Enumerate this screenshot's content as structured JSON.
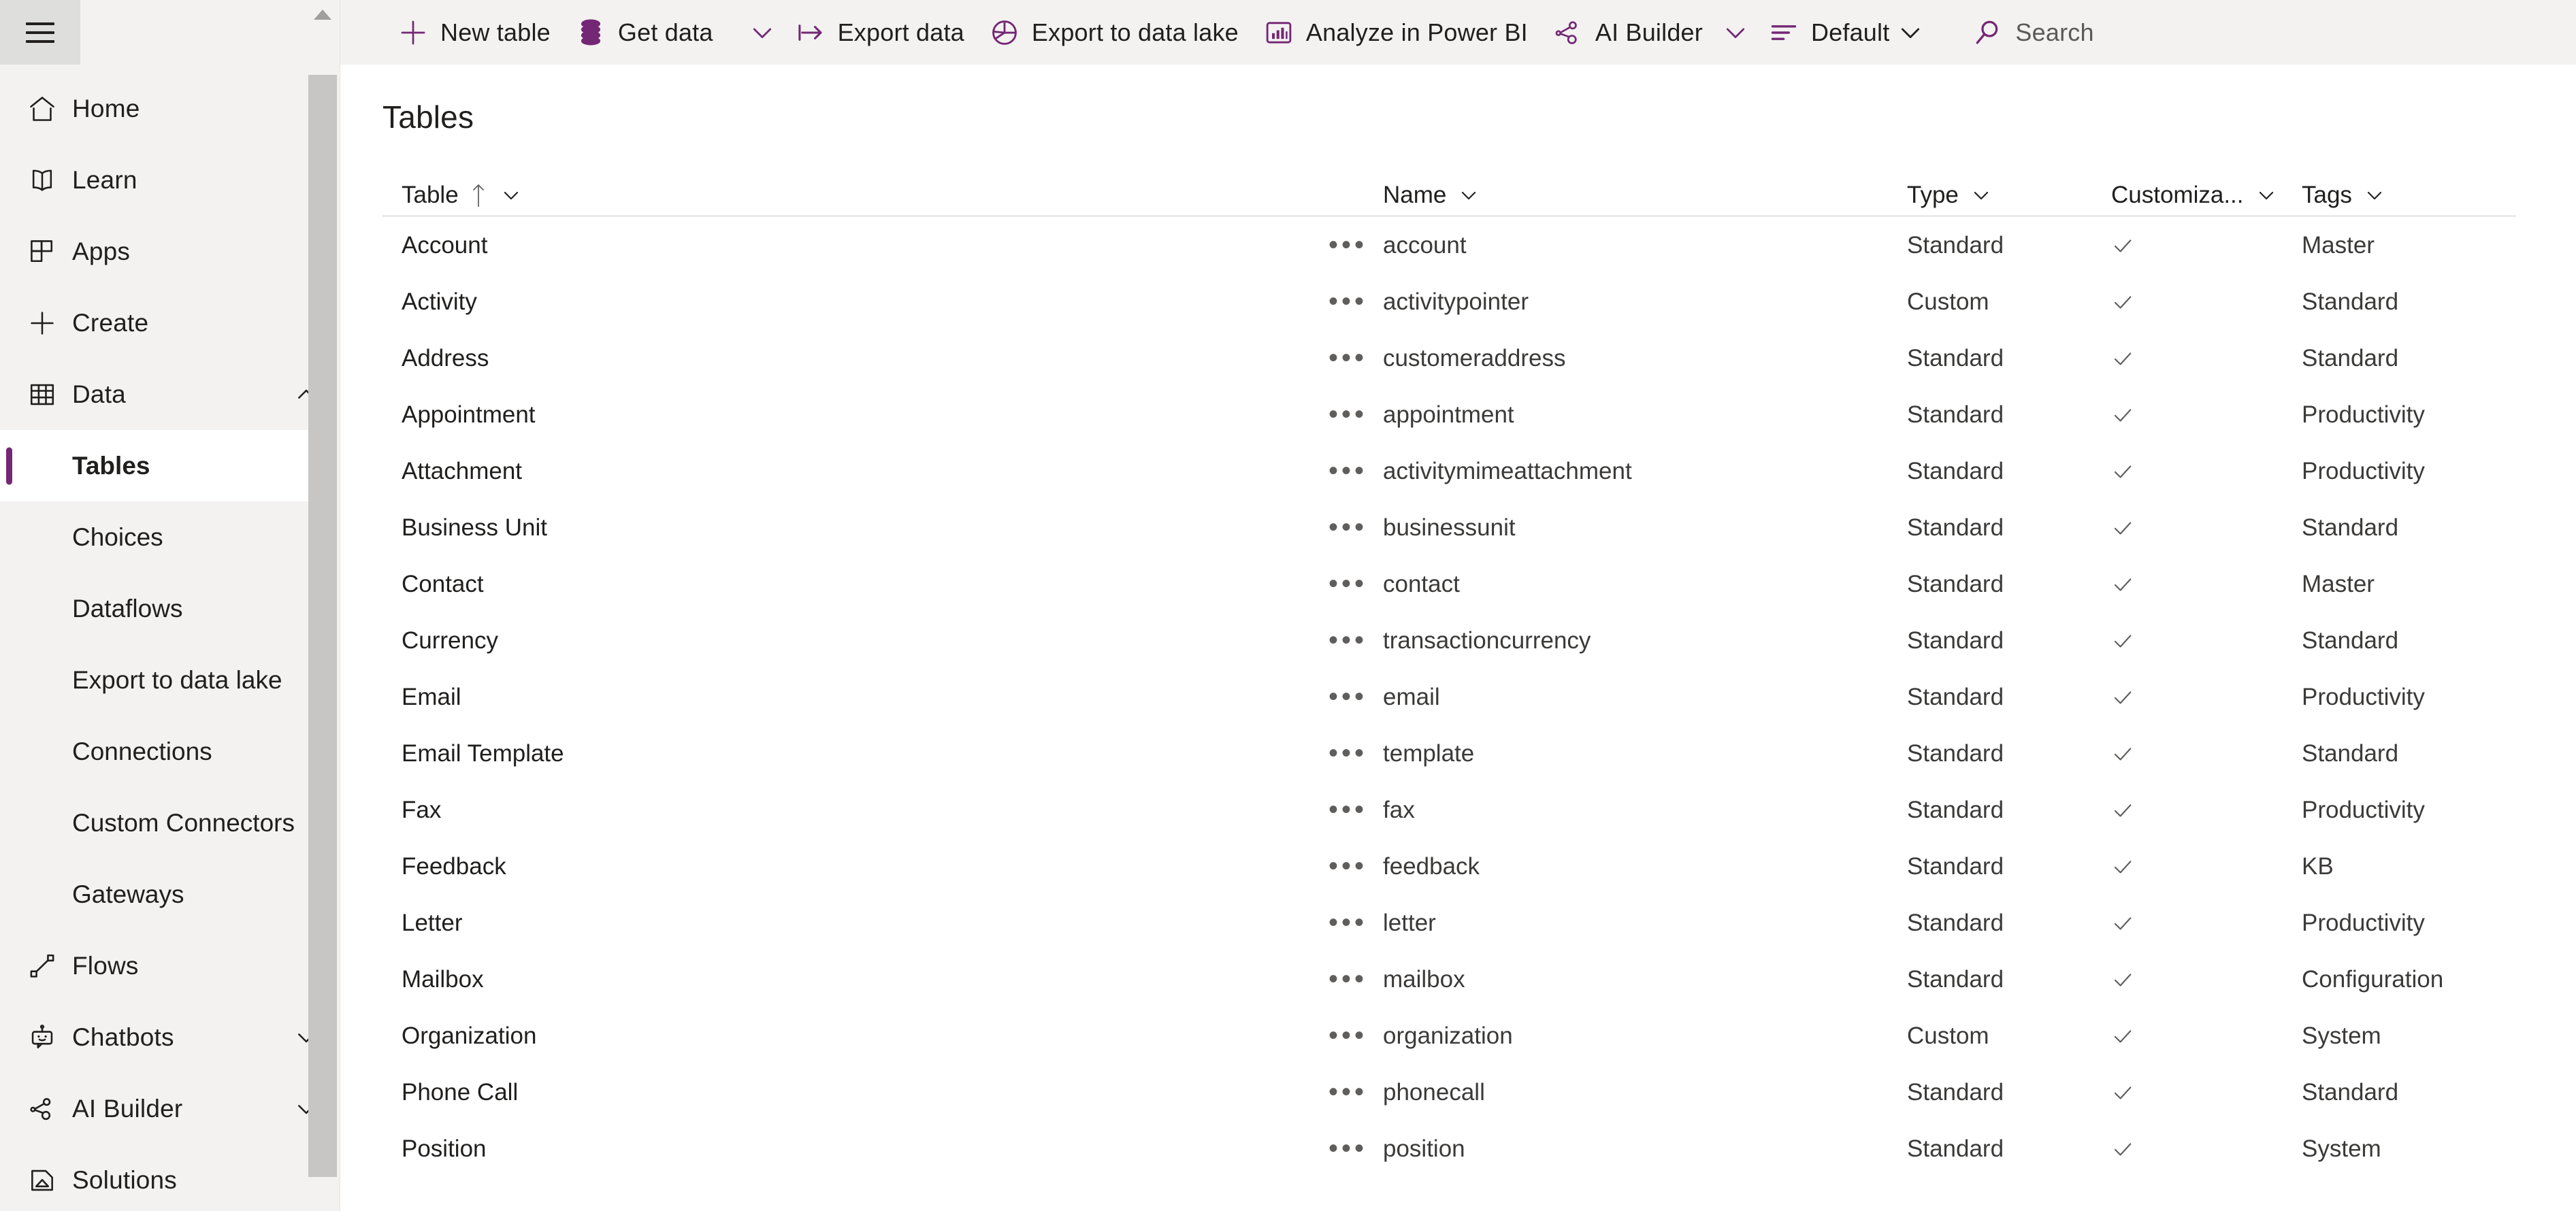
{
  "colors": {
    "accent": "#742774",
    "toolbar_bg": "#f3f2f1",
    "sidebar_bg": "#f3f2f1",
    "content_bg": "#ffffff",
    "text": "#201f1e",
    "muted_text": "#3b3a39"
  },
  "sidebar": {
    "hamburger": "menu-icon",
    "items": [
      {
        "label": "Home",
        "icon": "home-icon",
        "type": "top",
        "chevron": null
      },
      {
        "label": "Learn",
        "icon": "book-icon",
        "type": "top",
        "chevron": null
      },
      {
        "label": "Apps",
        "icon": "grid-apps-icon",
        "type": "top",
        "chevron": null
      },
      {
        "label": "Create",
        "icon": "plus-icon",
        "type": "top",
        "chevron": null
      },
      {
        "label": "Data",
        "icon": "table-grid-icon",
        "type": "top",
        "chevron": "up"
      },
      {
        "label": "Tables",
        "icon": null,
        "type": "sub",
        "selected": true
      },
      {
        "label": "Choices",
        "icon": null,
        "type": "sub",
        "selected": false
      },
      {
        "label": "Dataflows",
        "icon": null,
        "type": "sub",
        "selected": false
      },
      {
        "label": "Export to data lake",
        "icon": null,
        "type": "sub",
        "selected": false
      },
      {
        "label": "Connections",
        "icon": null,
        "type": "sub",
        "selected": false
      },
      {
        "label": "Custom Connectors",
        "icon": null,
        "type": "sub",
        "selected": false
      },
      {
        "label": "Gateways",
        "icon": null,
        "type": "sub",
        "selected": false
      },
      {
        "label": "Flows",
        "icon": "flow-icon",
        "type": "top",
        "chevron": null
      },
      {
        "label": "Chatbots",
        "icon": "chatbot-icon",
        "type": "top",
        "chevron": "down"
      },
      {
        "label": "AI Builder",
        "icon": "ai-builder-icon",
        "type": "top",
        "chevron": "down"
      },
      {
        "label": "Solutions",
        "icon": "solutions-icon",
        "type": "top",
        "chevron": null
      }
    ]
  },
  "toolbar": {
    "buttons": [
      {
        "label": "New table",
        "icon": "plus-icon"
      },
      {
        "label": "Get data",
        "icon": "database-icon",
        "caret": true
      },
      {
        "label": "Export data",
        "icon": "export-arrow-icon"
      },
      {
        "label": "Export to data lake",
        "icon": "pie-chart-icon"
      },
      {
        "label": "Analyze in Power BI",
        "icon": "power-bi-icon"
      },
      {
        "label": "AI Builder",
        "icon": "ai-builder-icon",
        "caret": true
      }
    ],
    "view_selector": {
      "label": "Default",
      "icon": "filter-lines-icon",
      "caret": true
    },
    "search": {
      "label": "Search",
      "icon": "search-icon"
    }
  },
  "page": {
    "title": "Tables"
  },
  "grid": {
    "columns": [
      {
        "key": "table",
        "label": "Table",
        "sort": "asc",
        "chevron": true
      },
      {
        "key": "name",
        "label": "Name",
        "sort": null,
        "chevron": true
      },
      {
        "key": "type",
        "label": "Type",
        "sort": null,
        "chevron": true
      },
      {
        "key": "customizable",
        "label": "Customiza...",
        "sort": null,
        "chevron": true
      },
      {
        "key": "tags",
        "label": "Tags",
        "sort": null,
        "chevron": true
      }
    ],
    "row_menu_glyph": "•••",
    "check_glyph": "check-icon",
    "rows": [
      {
        "table": "Account",
        "name": "account",
        "type": "Standard",
        "customizable": true,
        "tags": "Master"
      },
      {
        "table": "Activity",
        "name": "activitypointer",
        "type": "Custom",
        "customizable": true,
        "tags": "Standard"
      },
      {
        "table": "Address",
        "name": "customeraddress",
        "type": "Standard",
        "customizable": true,
        "tags": "Standard"
      },
      {
        "table": "Appointment",
        "name": "appointment",
        "type": "Standard",
        "customizable": true,
        "tags": "Productivity"
      },
      {
        "table": "Attachment",
        "name": "activitymimeattachment",
        "type": "Standard",
        "customizable": true,
        "tags": "Productivity"
      },
      {
        "table": "Business Unit",
        "name": "businessunit",
        "type": "Standard",
        "customizable": true,
        "tags": "Standard"
      },
      {
        "table": "Contact",
        "name": "contact",
        "type": "Standard",
        "customizable": true,
        "tags": "Master"
      },
      {
        "table": "Currency",
        "name": "transactioncurrency",
        "type": "Standard",
        "customizable": true,
        "tags": "Standard"
      },
      {
        "table": "Email",
        "name": "email",
        "type": "Standard",
        "customizable": true,
        "tags": "Productivity"
      },
      {
        "table": "Email Template",
        "name": "template",
        "type": "Standard",
        "customizable": true,
        "tags": "Standard"
      },
      {
        "table": "Fax",
        "name": "fax",
        "type": "Standard",
        "customizable": true,
        "tags": "Productivity"
      },
      {
        "table": "Feedback",
        "name": "feedback",
        "type": "Standard",
        "customizable": true,
        "tags": "KB"
      },
      {
        "table": "Letter",
        "name": "letter",
        "type": "Standard",
        "customizable": true,
        "tags": "Productivity"
      },
      {
        "table": "Mailbox",
        "name": "mailbox",
        "type": "Standard",
        "customizable": true,
        "tags": "Configuration"
      },
      {
        "table": "Organization",
        "name": "organization",
        "type": "Custom",
        "customizable": true,
        "tags": "System"
      },
      {
        "table": "Phone Call",
        "name": "phonecall",
        "type": "Standard",
        "customizable": true,
        "tags": "Standard"
      },
      {
        "table": "Position",
        "name": "position",
        "type": "Standard",
        "customizable": true,
        "tags": "System"
      }
    ]
  }
}
